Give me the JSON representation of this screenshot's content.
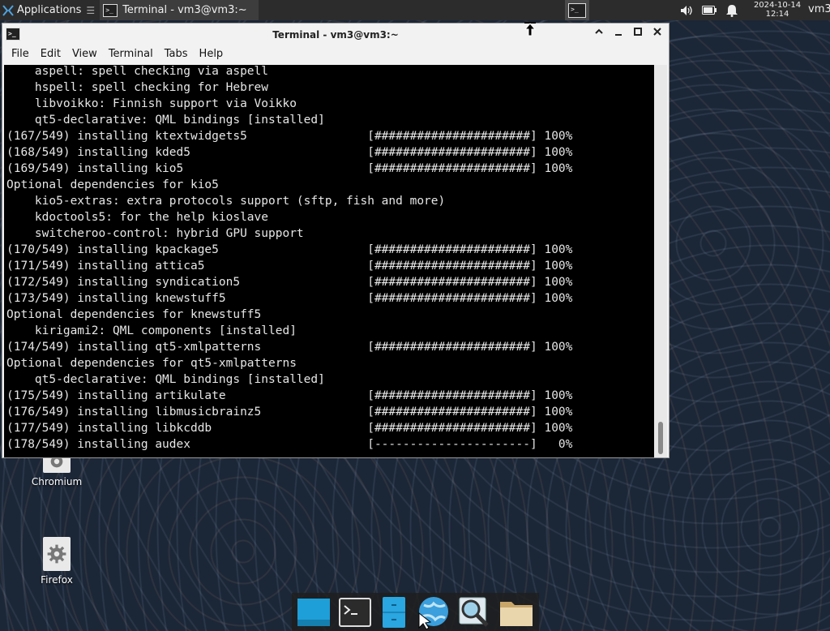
{
  "top_panel": {
    "applications_label": "Applications",
    "taskbar_window_title": "Terminal - vm3@vm3:~",
    "clock_date": "2024-10-14",
    "clock_time": "12:14",
    "user_label": "vm3",
    "icons": [
      "xfce-logo-icon",
      "terminal-icon",
      "volume-icon",
      "battery-icon",
      "notification-bell-icon"
    ]
  },
  "window": {
    "title": "Terminal - vm3@vm3:~",
    "menu": [
      "File",
      "Edit",
      "View",
      "Terminal",
      "Tabs",
      "Help"
    ],
    "terminal_lines": [
      "    aspell: spell checking via aspell",
      "    hspell: spell checking for Hebrew",
      "    libvoikko: Finnish support via Voikko",
      "    qt5-declarative: QML bindings [installed]",
      "(167/549) installing ktextwidgets5                 [######################] 100%",
      "(168/549) installing kded5                         [######################] 100%",
      "(169/549) installing kio5                          [######################] 100%",
      "Optional dependencies for kio5",
      "    kio5-extras: extra protocols support (sftp, fish and more)",
      "    kdoctools5: for the help kioslave",
      "    switcheroo-control: hybrid GPU support",
      "(170/549) installing kpackage5                     [######################] 100%",
      "(171/549) installing attica5                       [######################] 100%",
      "(172/549) installing syndication5                  [######################] 100%",
      "(173/549) installing knewstuff5                    [######################] 100%",
      "Optional dependencies for knewstuff5",
      "    kirigami2: QML components [installed]",
      "(174/549) installing qt5-xmlpatterns               [######################] 100%",
      "Optional dependencies for qt5-xmlpatterns",
      "    qt5-declarative: QML bindings [installed]",
      "(175/549) installing artikulate                    [######################] 100%",
      "(176/549) installing libmusicbrainz5               [######################] 100%",
      "(177/549) installing libkcddb                      [######################] 100%",
      "(178/549) installing audex                         [----------------------]   0%"
    ]
  },
  "desktop": {
    "icons": [
      {
        "label": "Chromium"
      },
      {
        "label": "Firefox"
      }
    ]
  },
  "dock": {
    "items": [
      "show-desktop-icon",
      "terminal-icon",
      "file-manager-icon",
      "web-browser-icon",
      "app-finder-icon",
      "folder-icon"
    ]
  }
}
